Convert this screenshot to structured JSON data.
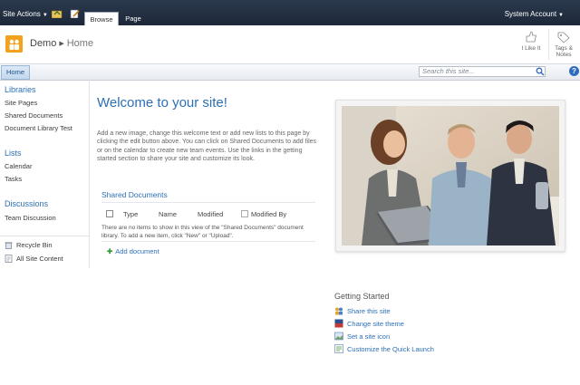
{
  "ribbon": {
    "site_actions": "Site Actions",
    "tabs": [
      {
        "label": "Browse"
      },
      {
        "label": "Page"
      }
    ],
    "account": "System Account"
  },
  "header": {
    "site": "Demo",
    "page": "Home",
    "tools": [
      {
        "label": "I Like It"
      },
      {
        "label": "Tags &",
        "label2": "Notes"
      }
    ]
  },
  "topnav": {
    "home": "Home",
    "search_placeholder": "Search this site..."
  },
  "quick_launch": {
    "libraries": {
      "title": "Libraries",
      "items": [
        "Site Pages",
        "Shared Documents",
        "Document Library Test"
      ]
    },
    "lists": {
      "title": "Lists",
      "items": [
        "Calendar",
        "Tasks"
      ]
    },
    "discussions": {
      "title": "Discussions",
      "items": [
        "Team Discussion"
      ]
    },
    "footer": [
      "Recycle Bin",
      "All Site Content"
    ]
  },
  "main": {
    "title": "Welcome to your site!",
    "intro": "Add a new image, change this welcome text or add new lists to this page by clicking the edit button above. You can click on Shared Documents to add files or on the calendar to create new team events. Use the links in the getting started section to share your site and customize its look.",
    "shared_documents": {
      "title": "Shared Documents",
      "columns": [
        "Type",
        "Name",
        "Modified",
        "Modified By"
      ],
      "empty": "There are no items to show in this view of the \"Shared Documents\" document library. To add a new item, click \"New\" or \"Upload\".",
      "add": "Add document"
    }
  },
  "getting_started": {
    "title": "Getting Started",
    "items": [
      "Share this site",
      "Change site theme",
      "Set a site icon",
      "Customize the Quick Launch"
    ]
  },
  "colors": {
    "accent": "#2c6fb6",
    "ribbon": "#1d2838",
    "logo": "#f2a21e"
  }
}
